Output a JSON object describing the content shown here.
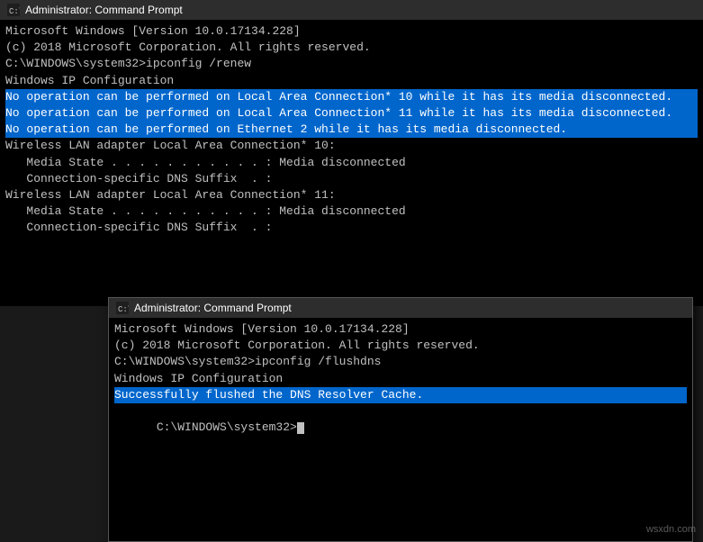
{
  "topWindow": {
    "title": "Administrator: Command Prompt",
    "lines": [
      "Microsoft Windows [Version 10.0.17134.228]",
      "(c) 2018 Microsoft Corporation. All rights reserved.",
      "",
      "C:\\WINDOWS\\system32>ipconfig /renew",
      "",
      "Windows IP Configuration",
      "",
      "No operation can be performed on Local Area Connection* 10 while it has its media disconnected.",
      "No operation can be performed on Local Area Connection* 11 while it has its media disconnected.",
      "No operation can be performed on Ethernet 2 while it has its media disconnected.",
      "",
      "Wireless LAN adapter Local Area Connection* 10:",
      "",
      "   Media State . . . . . . . . . . . : Media disconnected",
      "   Connection-specific DNS Suffix  . :",
      "",
      "Wireless LAN adapter Local Area Connection* 11:",
      "",
      "   Media State . . . . . . . . . . . : Media disconnected",
      "   Connection-specific DNS Suffix  . :"
    ]
  },
  "bottomWindow": {
    "title": "Administrator: Command Prompt",
    "lines": [
      "Microsoft Windows [Version 10.0.17134.228]",
      "(c) 2018 Microsoft Corporation. All rights reserved.",
      "",
      "C:\\WINDOWS\\system32>ipconfig /flushdns",
      "",
      "Windows IP Configuration",
      "",
      "Successfully flushed the DNS Resolver Cache.",
      "",
      "C:\\WINDOWS\\system32>"
    ]
  },
  "watermark": "wsxdn.com",
  "highlightLines": [
    7,
    8,
    9
  ]
}
